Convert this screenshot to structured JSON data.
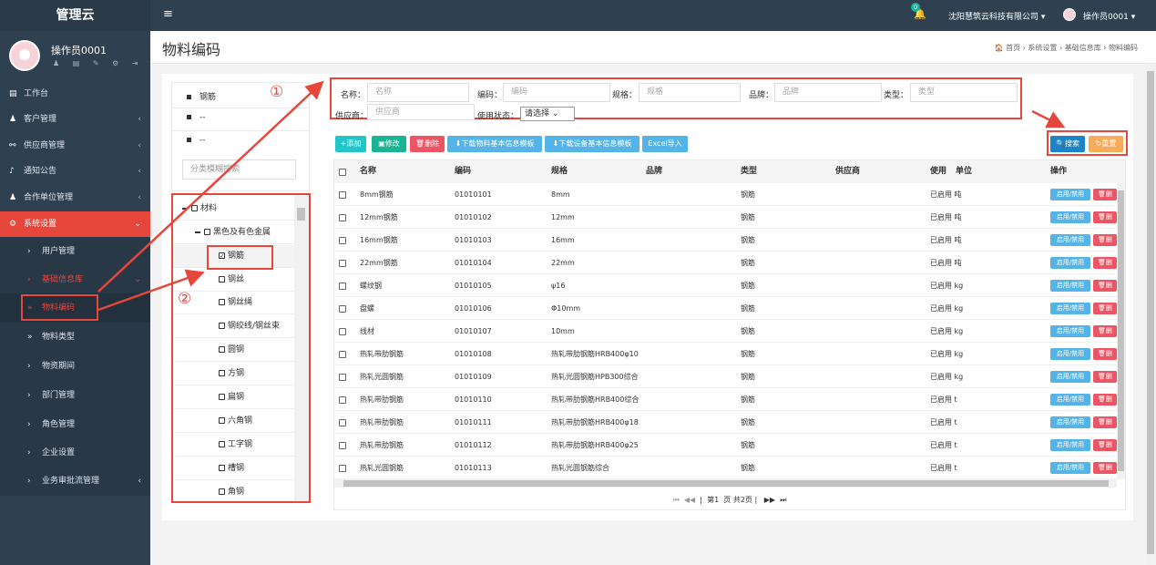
{
  "sidebar": {
    "brand": "管理云",
    "user": "操作员0001",
    "user_icons": "♟ ▤ ✎ ⚙ ⇥",
    "nav": [
      {
        "label": "工作台",
        "icon": "▤"
      },
      {
        "label": "客户管理",
        "icon": "♟",
        "chev": "‹"
      },
      {
        "label": "供应商管理",
        "icon": "⚯",
        "chev": "‹"
      },
      {
        "label": "通知公告",
        "icon": "♪",
        "chev": "‹"
      },
      {
        "label": "合作单位管理",
        "icon": "♟",
        "chev": "‹"
      },
      {
        "label": "系统设置",
        "icon": "⚙",
        "chev": "⌄"
      }
    ],
    "sub": [
      {
        "label": "用户管理",
        "ar": "›"
      },
      {
        "label": "基础信息库",
        "ar": "›",
        "chev": "⌄"
      },
      {
        "label": "物料编码",
        "ar": "»"
      },
      {
        "label": "物料类型",
        "ar": "»"
      },
      {
        "label": "物资期间",
        "ar": "›"
      },
      {
        "label": "部门管理",
        "ar": "›"
      },
      {
        "label": "角色管理",
        "ar": "›"
      },
      {
        "label": "企业设置",
        "ar": "›"
      },
      {
        "label": "业务审批流管理",
        "ar": "›",
        "chev": "‹"
      }
    ]
  },
  "topbar": {
    "menu_icon": "≡",
    "bell_icon": "🔔",
    "badge": "0",
    "company": "沈阳慧筑云科技有限公司 ▾",
    "operator": "操作员0001 ▾"
  },
  "page": {
    "title": "物料编码",
    "breadcrumb": "🏠 首页 › 系统设置 › 基础信息库 › 物料编码"
  },
  "left_panel": {
    "items": [
      "钢筋",
      "--",
      "--"
    ],
    "search_placeholder": "分类模糊搜索"
  },
  "tree": [
    {
      "label": "材料",
      "level": 0,
      "expanded": true
    },
    {
      "label": "黑色及有色金属",
      "level": 1,
      "expanded": true
    },
    {
      "label": "钢筋",
      "level": 2,
      "checked": true
    },
    {
      "label": "钢丝",
      "level": 2
    },
    {
      "label": "钢丝绳",
      "level": 2
    },
    {
      "label": "钢绞线/钢丝束",
      "level": 2
    },
    {
      "label": "圆钢",
      "level": 2
    },
    {
      "label": "方钢",
      "level": 2
    },
    {
      "label": "扁钢",
      "level": 2
    },
    {
      "label": "六角钢",
      "level": 2
    },
    {
      "label": "工字钢",
      "level": 2
    },
    {
      "label": "槽钢",
      "level": 2
    },
    {
      "label": "角钢",
      "level": 2
    }
  ],
  "filter": {
    "name_label": "名称：",
    "name_ph": "名称",
    "code_label": "编码：",
    "code_ph": "编码",
    "spec_label": "规格：",
    "spec_ph": "规格",
    "brand_label": "品牌：",
    "brand_ph": "品牌",
    "type_label": "类型：",
    "type_ph": "类型",
    "supplier_label": "供应商：",
    "supplier_ph": "供应商",
    "status_label": "使用状态：",
    "status_value": "请选择 ⌄"
  },
  "toolbar": {
    "add": "+添加",
    "edit": "▣修改",
    "del": "🗑删除",
    "dl_material": "⬇下载物料基本信息模板",
    "dl_device": "⬇下载设备基本信息模板",
    "excel": "Excel导入",
    "search": "🔍搜索",
    "reset": "↻重置"
  },
  "colors": {
    "sidebar": "#2f4050",
    "accent_red": "#e7463a",
    "add_btn": "#23c6c8",
    "edit_btn": "#1ab394",
    "del_btn": "#ed5565",
    "dl_btn": "#1c84c6",
    "info_btn": "#54b4e8",
    "reset_btn": "#f8ac59"
  },
  "table": {
    "headers": {
      "name": "名称",
      "code": "编码",
      "spec": "规格",
      "brand": "品牌",
      "type": "类型",
      "supplier": "供应商",
      "use": "使用",
      "unit": "单位",
      "op": "操作"
    },
    "action_toggle": "启用/禁用",
    "action_del": "🗑删",
    "rows": [
      {
        "name": "8mm钢筋",
        "code": "01010101",
        "spec": "8mm",
        "type": "钢筋",
        "status": "已启用 吨"
      },
      {
        "name": "12mm钢筋",
        "code": "01010102",
        "spec": "12mm",
        "type": "钢筋",
        "status": "已启用 吨"
      },
      {
        "name": "16mm钢筋",
        "code": "01010103",
        "spec": "16mm",
        "type": "钢筋",
        "status": "已启用 吨"
      },
      {
        "name": "22mm钢筋",
        "code": "01010104",
        "spec": "22mm",
        "type": "钢筋",
        "status": "已启用 吨"
      },
      {
        "name": "螺纹钢",
        "code": "01010105",
        "spec": "ψ16",
        "type": "钢筋",
        "status": "已启用 kg"
      },
      {
        "name": "盘螺",
        "code": "01010106",
        "spec": "Φ10mm",
        "type": "钢筋",
        "status": "已启用 kg"
      },
      {
        "name": "线材",
        "code": "01010107",
        "spec": "10mm",
        "type": "钢筋",
        "status": "已启用 kg"
      },
      {
        "name": "热轧带肋钢筋",
        "code": "01010108",
        "spec": "热轧带肋钢筋HRB400φ10",
        "type": "钢筋",
        "status": "已启用 kg"
      },
      {
        "name": "热轧光圆钢筋",
        "code": "01010109",
        "spec": "热轧光圆钢筋HPB300综合",
        "type": "钢筋",
        "status": "已启用 kg"
      },
      {
        "name": "热轧带肋钢筋",
        "code": "01010110",
        "spec": "热轧带肋钢筋HRB400综合",
        "type": "钢筋",
        "status": "已启用 t"
      },
      {
        "name": "热轧带肋钢筋",
        "code": "01010111",
        "spec": "热轧带肋钢筋HRB400φ18",
        "type": "钢筋",
        "status": "已启用 t"
      },
      {
        "name": "热轧带肋钢筋",
        "code": "01010112",
        "spec": "热轧带肋钢筋HRB400φ25",
        "type": "钢筋",
        "status": "已启用 t"
      },
      {
        "name": "热轧光圆钢筋",
        "code": "01010113",
        "spec": "热轧光圆钢筋综合",
        "type": "钢筋",
        "status": "已启用 t"
      }
    ]
  },
  "pager": {
    "first": "⏮",
    "prev": "◀◀",
    "label_a": "第",
    "page": "1",
    "label_b": "页 共",
    "total": "2",
    "label_c": "页",
    "next": "▶▶",
    "last": "⏭"
  },
  "annotations": {
    "one": "①",
    "two": "②"
  }
}
